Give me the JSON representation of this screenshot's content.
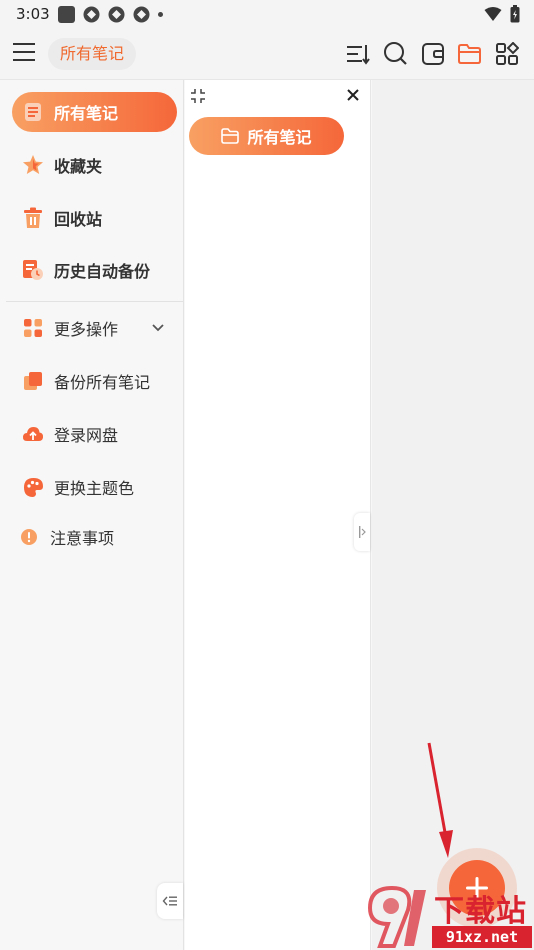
{
  "status_bar": {
    "time": "3:03"
  },
  "app_bar": {
    "title": "所有笔记",
    "actions": [
      "sort-icon",
      "search-icon",
      "wallet-icon",
      "folder-icon",
      "grid-icon"
    ],
    "accent_color": "#f5673a"
  },
  "sidebar": {
    "items": [
      {
        "label": "所有笔记",
        "icon": "notes-icon",
        "active": true
      },
      {
        "label": "收藏夹",
        "icon": "star-icon"
      },
      {
        "label": "回收站",
        "icon": "trash-icon"
      },
      {
        "label": "历史自动备份",
        "icon": "history-backup-icon"
      },
      {
        "label": "更多操作",
        "icon": "more-actions-icon"
      },
      {
        "label": "备份所有笔记",
        "icon": "backup-icon"
      },
      {
        "label": "登录网盘",
        "icon": "cloud-upload-icon"
      },
      {
        "label": "更换主题色",
        "icon": "palette-icon"
      },
      {
        "label": "注意事项",
        "icon": "alert-icon"
      }
    ]
  },
  "folder_panel": {
    "folder_label": "所有笔记"
  },
  "fab": {
    "icon": "plus-icon"
  },
  "watermark": {
    "brand": "下载站",
    "url": "91xz.net"
  }
}
